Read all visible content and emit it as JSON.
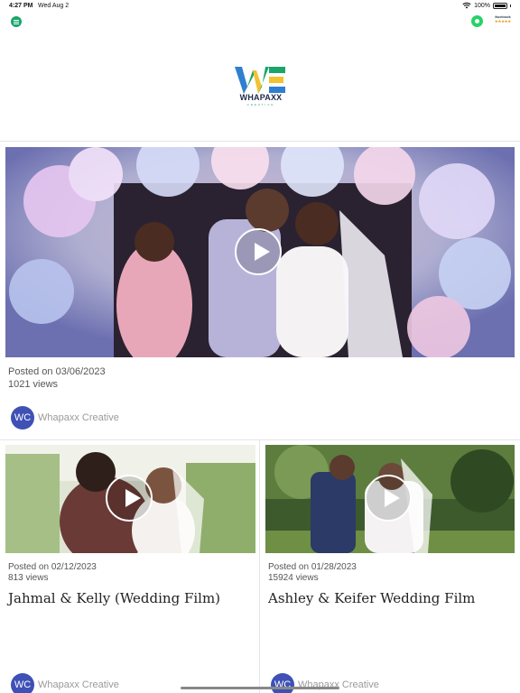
{
  "status_bar": {
    "time": "4:27 PM",
    "date": "Wed Aug 2",
    "battery_text": "100%"
  },
  "header": {
    "logo_word": "WHAPAXX",
    "logo_sub": "CREATIVE",
    "facebook_label": "facebook",
    "facebook_stars": "★★★★★",
    "icons": [
      "menu-icon",
      "whatsapp-icon",
      "facebook-rating-icon"
    ],
    "brand_colors": {
      "green": "#1aa56b",
      "blue": "#2f7fd1",
      "yellow": "#f2c230",
      "navy": "#1d2a4a"
    }
  },
  "featured": {
    "posted": "Posted on 03/06/2023",
    "views": "1021 views",
    "author_initials": "WC",
    "author_name": "Whapaxx Creative"
  },
  "posts": [
    {
      "posted": "Posted on 02/12/2023",
      "views": "813 views",
      "title": "Jahmal & Kelly (Wedding Film)",
      "author_initials": "WC",
      "author_name": "Whapaxx Creative"
    },
    {
      "posted": "Posted on 01/28/2023",
      "views": "15924 views",
      "title": "Ashley & Keifer Wedding Film",
      "author_initials": "WC",
      "author_name": "Whapaxx Creative"
    }
  ],
  "accent_colors": {
    "avatar": "#3f51b5"
  }
}
